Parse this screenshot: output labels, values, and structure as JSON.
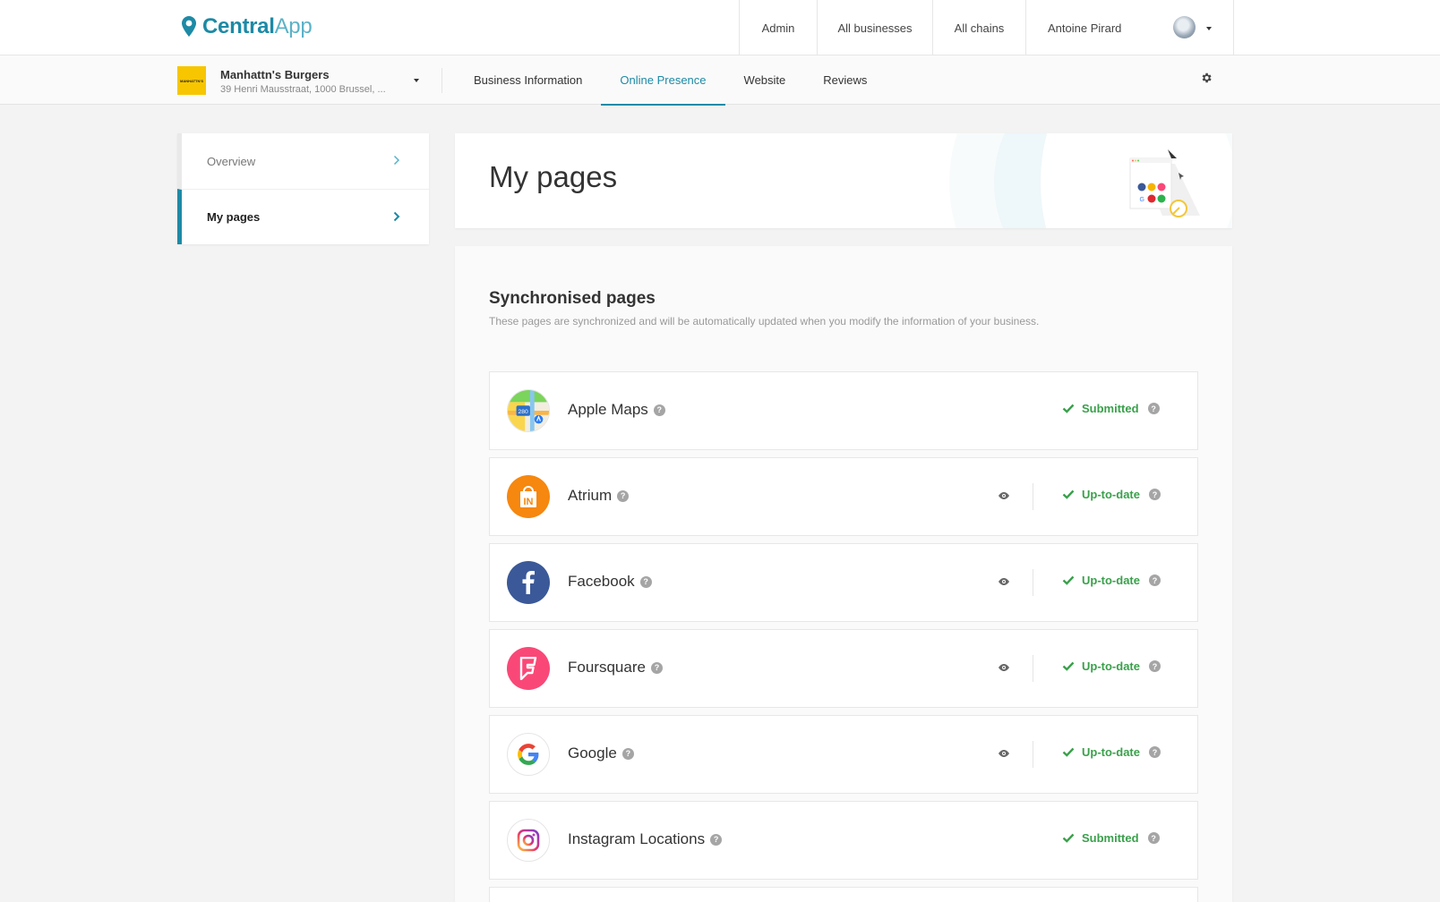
{
  "topbar": {
    "logo_bold": "Central",
    "logo_light": "App",
    "nav": [
      "Admin",
      "All businesses",
      "All chains"
    ],
    "user_name": "Antoine Pirard"
  },
  "business": {
    "logo_text": "MANHATTN'S",
    "name": "Manhattn's Burgers",
    "address": "39 Henri Mausstraat, 1000 Brussel, ..."
  },
  "tabs": [
    {
      "label": "Business Information",
      "active": false
    },
    {
      "label": "Online Presence",
      "active": true
    },
    {
      "label": "Website",
      "active": false
    },
    {
      "label": "Reviews",
      "active": false
    }
  ],
  "sidemenu": [
    {
      "label": "Overview",
      "active": false
    },
    {
      "label": "My pages",
      "active": true
    }
  ],
  "header": {
    "title": "My pages"
  },
  "section": {
    "title": "Synchronised pages",
    "description": "These pages are synchronized and will be automatically updated when you modify the information of your business."
  },
  "pages": [
    {
      "name": "Apple Maps",
      "icon": "apple-maps-icon",
      "status": "Submitted",
      "viewable": false
    },
    {
      "name": "Atrium",
      "icon": "atrium-icon",
      "status": "Up-to-date",
      "viewable": true
    },
    {
      "name": "Facebook",
      "icon": "facebook-icon",
      "status": "Up-to-date",
      "viewable": true
    },
    {
      "name": "Foursquare",
      "icon": "foursquare-icon",
      "status": "Up-to-date",
      "viewable": true
    },
    {
      "name": "Google",
      "icon": "google-icon",
      "status": "Up-to-date",
      "viewable": true
    },
    {
      "name": "Instagram Locations",
      "icon": "instagram-icon",
      "status": "Submitted",
      "viewable": false
    }
  ],
  "colors": {
    "accent": "#1d8aa6",
    "status_green": "#3aa04b",
    "business_logo": "#f7c600",
    "atrium": "#f6870f",
    "facebook": "#3b5998",
    "foursquare": "#f94877"
  }
}
